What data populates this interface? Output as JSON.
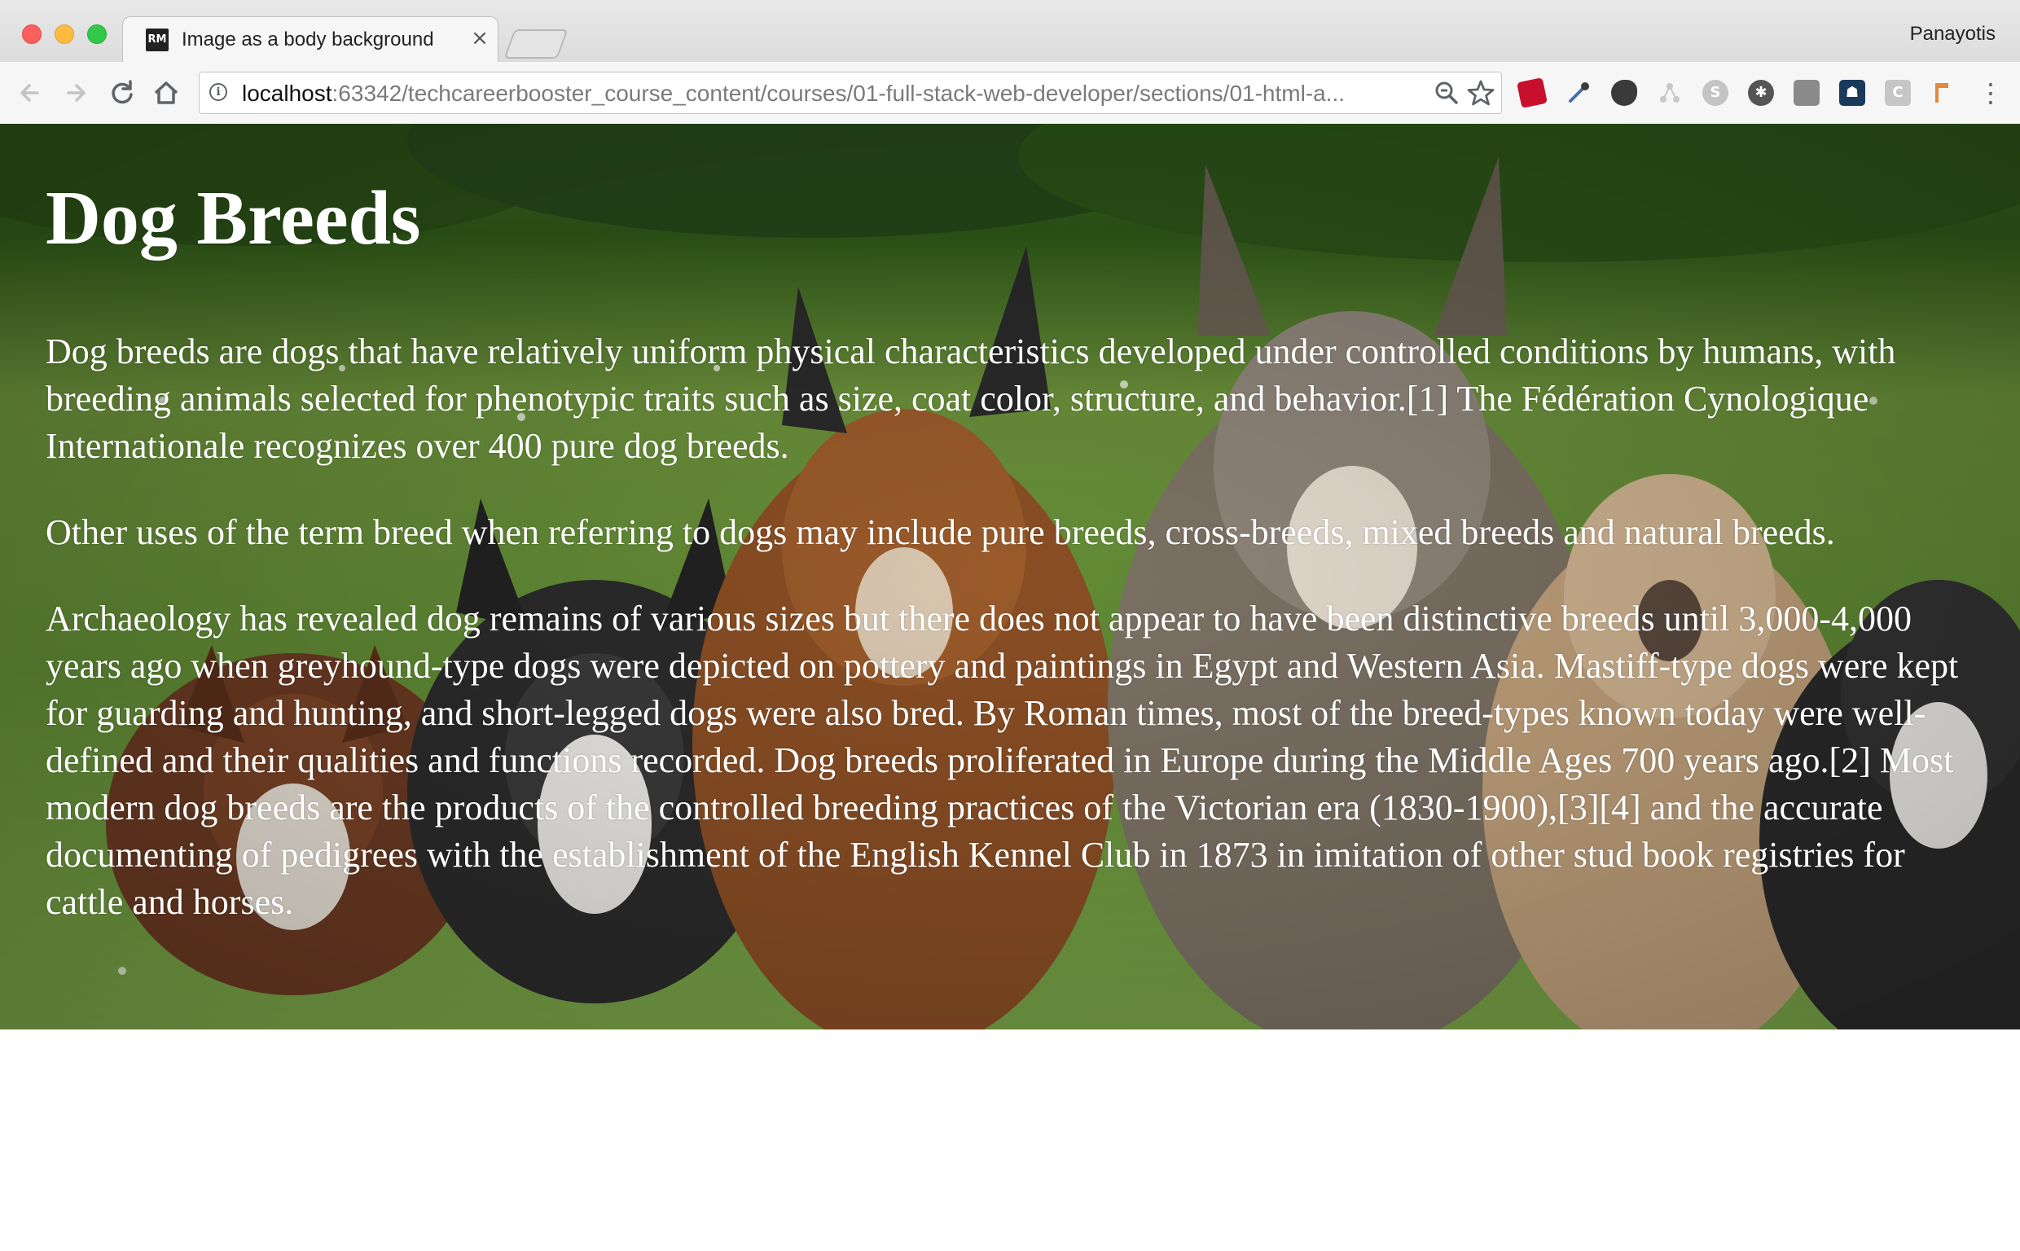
{
  "browser": {
    "tab": {
      "favicon_text": "RM",
      "title": "Image as a body background",
      "close_symbol": "×"
    },
    "profile_name": "Panayotis",
    "nav": {
      "back_icon": "arrow-left-icon",
      "forward_icon": "arrow-right-icon",
      "reload_icon": "reload-icon",
      "home_icon": "home-icon"
    },
    "address": {
      "host": "localhost",
      "rest": ":63342/techcareerbooster_course_content/courses/01-full-stack-web-developer/sections/01-html-a..."
    },
    "extensions": [
      {
        "name": "ruby-gem-icon",
        "color": "#c8102e"
      },
      {
        "name": "eyedropper-icon",
        "color": "#4a6fa5"
      },
      {
        "name": "evernote-icon",
        "color": "#3a3a3a"
      },
      {
        "name": "network-icon",
        "color": "#c8c8c8"
      },
      {
        "name": "skype-icon",
        "color": "#b0b0b0"
      },
      {
        "name": "wheel-icon",
        "color": "#555555"
      },
      {
        "name": "box-icon",
        "color": "#8a8a8a"
      },
      {
        "name": "shield-icon",
        "color": "#1a3a5c"
      },
      {
        "name": "c-icon",
        "color": "#bdbdbd"
      },
      {
        "name": "tag-icon",
        "color": "#e08a3c"
      }
    ]
  },
  "page": {
    "heading": "Dog Breeds",
    "paragraphs": [
      "Dog breeds are dogs that have relatively uniform physical characteristics developed under controlled conditions by humans, with breeding animals selected for phenotypic traits such as size, coat color, structure, and behavior.[1] The Fédération Cynologique Internationale recognizes over 400 pure dog breeds.",
      "Other uses of the term breed when referring to dogs may include pure breeds, cross-breeds, mixed breeds and natural breeds.",
      "Archaeology has revealed dog remains of various sizes but there does not appear to have been distinctive breeds until 3,000-4,000 years ago when greyhound-type dogs were depicted on pottery and paintings in Egypt and Western Asia. Mastiff-type dogs were kept for guarding and hunting, and short-legged dogs were also bred. By Roman times, most of the breed-types known today were well-defined and their qualities and functions recorded. Dog breeds proliferated in Europe during the Middle Ages 700 years ago.[2] Most modern dog breeds are the products of the controlled breeding practices of the Victorian era (1830-1900),[3][4] and the accurate documenting of pedigrees with the establishment of the English Kennel Club in 1873 in imitation of other stud book registries for cattle and horses."
    ]
  }
}
